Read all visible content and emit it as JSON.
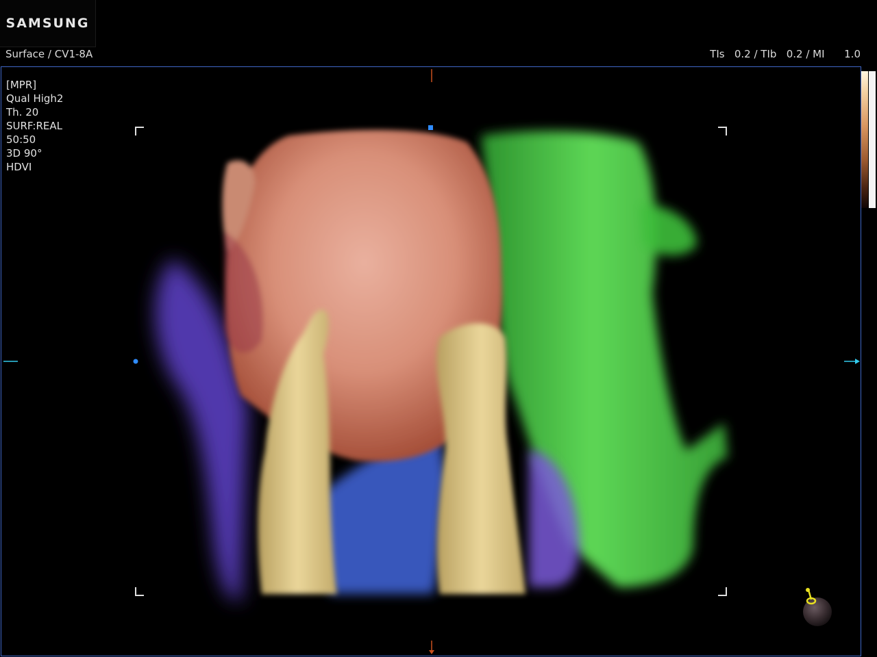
{
  "header": {
    "brand": "SAMSUNG",
    "probe_preset": "Surface / CV1-8A",
    "index_readout": "TIs   0.2 / TIb   0.2 / MI      1.0"
  },
  "viewport": {
    "params": [
      "[MPR]",
      "Qual High2",
      "Th. 20",
      "SURF:REAL",
      "50:50",
      "3D 90°",
      "HDVI"
    ]
  },
  "colors": {
    "frame": "#3f67c8",
    "center_marker": "#2f8cff",
    "axis_cursor": "#c8501e",
    "side_arrow": "#33ccee",
    "fetal_skin": "#d99a86",
    "limb": "#e0cc8e",
    "green_tissue": "#4fd64a",
    "purple_tissue": "#5a3fbf",
    "blue_tissue": "#3f5fcf"
  },
  "icons": {
    "colorbar": "grayscale-colormap-bar",
    "orientation": "orientation-ball-icon"
  }
}
